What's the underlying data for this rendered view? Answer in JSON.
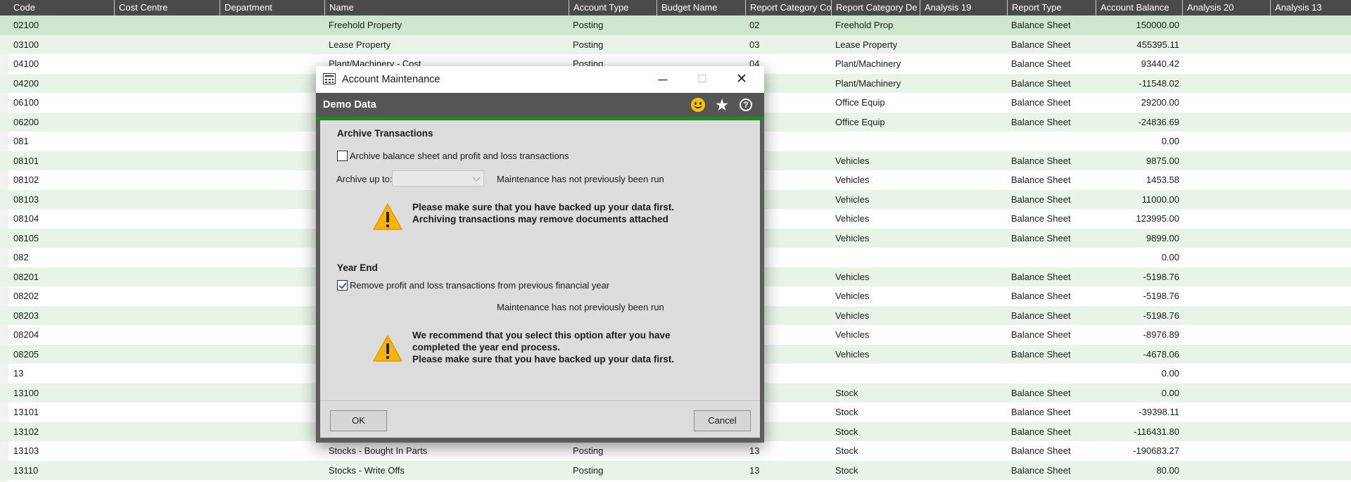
{
  "grid": {
    "columns": [
      "Code",
      "Cost Centre",
      "Department",
      "Name",
      "Account Type",
      "Budget Name",
      "Report Category Co",
      "Report Category De",
      "Analysis 19",
      "Report Type",
      "Account Balance",
      "Analysis 20",
      "Analysis 13"
    ],
    "rows": [
      {
        "code": "02100",
        "name": "Freehold Property",
        "type": "Posting",
        "rc": "02",
        "rcd": "Freehold Prop",
        "rt": "Balance Sheet",
        "bal": "150000.00"
      },
      {
        "code": "03100",
        "name": "Lease Property",
        "type": "Posting",
        "rc": "03",
        "rcd": "Lease Property",
        "rt": "Balance Sheet",
        "bal": "455395.11"
      },
      {
        "code": "04100",
        "name": "Plant/Machinery - Cost",
        "type": "Posting",
        "rc": "04",
        "rcd": "Plant/Machinery",
        "rt": "Balance Sheet",
        "bal": "93440.42"
      },
      {
        "code": "04200",
        "name": "",
        "type": "",
        "rc": "",
        "rcd": "Plant/Machinery",
        "rt": "Balance Sheet",
        "bal": "-11548.02"
      },
      {
        "code": "06100",
        "name": "",
        "type": "",
        "rc": "",
        "rcd": "Office Equip",
        "rt": "Balance Sheet",
        "bal": "29200.00"
      },
      {
        "code": "06200",
        "name": "",
        "type": "",
        "rc": "",
        "rcd": "Office Equip",
        "rt": "Balance Sheet",
        "bal": "-24836.69"
      },
      {
        "code": "081",
        "name": "",
        "type": "",
        "rc": "",
        "rcd": "",
        "rt": "",
        "bal": "0.00"
      },
      {
        "code": "08101",
        "name": "",
        "type": "",
        "rc": "",
        "rcd": "Vehicles",
        "rt": "Balance Sheet",
        "bal": "9875.00"
      },
      {
        "code": "08102",
        "name": "",
        "type": "",
        "rc": "",
        "rcd": "Vehicles",
        "rt": "Balance Sheet",
        "bal": "1453.58"
      },
      {
        "code": "08103",
        "name": "",
        "type": "",
        "rc": "",
        "rcd": "Vehicles",
        "rt": "Balance Sheet",
        "bal": "11000.00"
      },
      {
        "code": "08104",
        "name": "",
        "type": "",
        "rc": "",
        "rcd": "Vehicles",
        "rt": "Balance Sheet",
        "bal": "123995.00"
      },
      {
        "code": "08105",
        "name": "",
        "type": "",
        "rc": "",
        "rcd": "Vehicles",
        "rt": "Balance Sheet",
        "bal": "9899.00"
      },
      {
        "code": "082",
        "name": "",
        "type": "",
        "rc": "",
        "rcd": "",
        "rt": "",
        "bal": "0.00"
      },
      {
        "code": "08201",
        "name": "",
        "type": "",
        "rc": "",
        "rcd": "Vehicles",
        "rt": "Balance Sheet",
        "bal": "-5198.76"
      },
      {
        "code": "08202",
        "name": "",
        "type": "",
        "rc": "",
        "rcd": "Vehicles",
        "rt": "Balance Sheet",
        "bal": "-5198.76"
      },
      {
        "code": "08203",
        "name": "",
        "type": "",
        "rc": "",
        "rcd": "Vehicles",
        "rt": "Balance Sheet",
        "bal": "-5198.76"
      },
      {
        "code": "08204",
        "name": "",
        "type": "",
        "rc": "",
        "rcd": "Vehicles",
        "rt": "Balance Sheet",
        "bal": "-8976.89"
      },
      {
        "code": "08205",
        "name": "",
        "type": "",
        "rc": "",
        "rcd": "Vehicles",
        "rt": "Balance Sheet",
        "bal": "-4678.06"
      },
      {
        "code": "13",
        "name": "",
        "type": "",
        "rc": "",
        "rcd": "",
        "rt": "",
        "bal": "0.00"
      },
      {
        "code": "13100",
        "name": "",
        "type": "",
        "rc": "",
        "rcd": "Stock",
        "rt": "Balance Sheet",
        "bal": "0.00"
      },
      {
        "code": "13101",
        "name": "",
        "type": "",
        "rc": "",
        "rcd": "Stock",
        "rt": "Balance Sheet",
        "bal": "-39398.11"
      },
      {
        "code": "13102",
        "name": "",
        "type": "",
        "rc": "",
        "rcd": "Stock",
        "rt": "Balance Sheet",
        "bal": "-116431.80"
      },
      {
        "code": "13103",
        "name": "Stocks - Bought In Parts",
        "type": "Posting",
        "rc": "13",
        "rcd": "Stock",
        "rt": "Balance Sheet",
        "bal": "-190683.27"
      },
      {
        "code": "13110",
        "name": "Stocks - Write Offs",
        "type": "Posting",
        "rc": "13",
        "rcd": "Stock",
        "rt": "Balance Sheet",
        "bal": "80.00"
      }
    ]
  },
  "dialog": {
    "title": "Account Maintenance",
    "minimize": "─",
    "maximize": "☐",
    "close": "✕",
    "company": "Demo Data",
    "archive": {
      "heading": "Archive Transactions",
      "checkbox_label": "Archive balance sheet and profit and loss transactions",
      "checked": false,
      "archive_up_to_label": "Archive up to:",
      "combo_value": "",
      "status": "Maintenance has not previously been run",
      "warning_line1": "Please make sure that you have backed up your data first.",
      "warning_line2": "Archiving transactions may remove documents attached"
    },
    "year_end": {
      "heading": "Year End",
      "checkbox_label": "Remove profit and loss transactions from previous financial year",
      "checked": true,
      "status": "Maintenance has not previously been run",
      "warning_line1": "We recommend that you select this option after you have",
      "warning_line2": "completed the year end process.",
      "warning_line3": "Please make sure that you have backed up your data first."
    },
    "ok_label": "OK",
    "cancel_label": "Cancel"
  },
  "colors": {
    "header_bg": "#4a4a4a",
    "row_shade": "#e8f4e8",
    "accent_green": "#1b8a1b",
    "warning_yellow": "#f7b500"
  },
  "icons": {
    "app": "account-maintenance-icon",
    "feedback": "smiley-icon",
    "favourite": "star-icon",
    "help": "help-icon",
    "warning": "warning-icon"
  }
}
